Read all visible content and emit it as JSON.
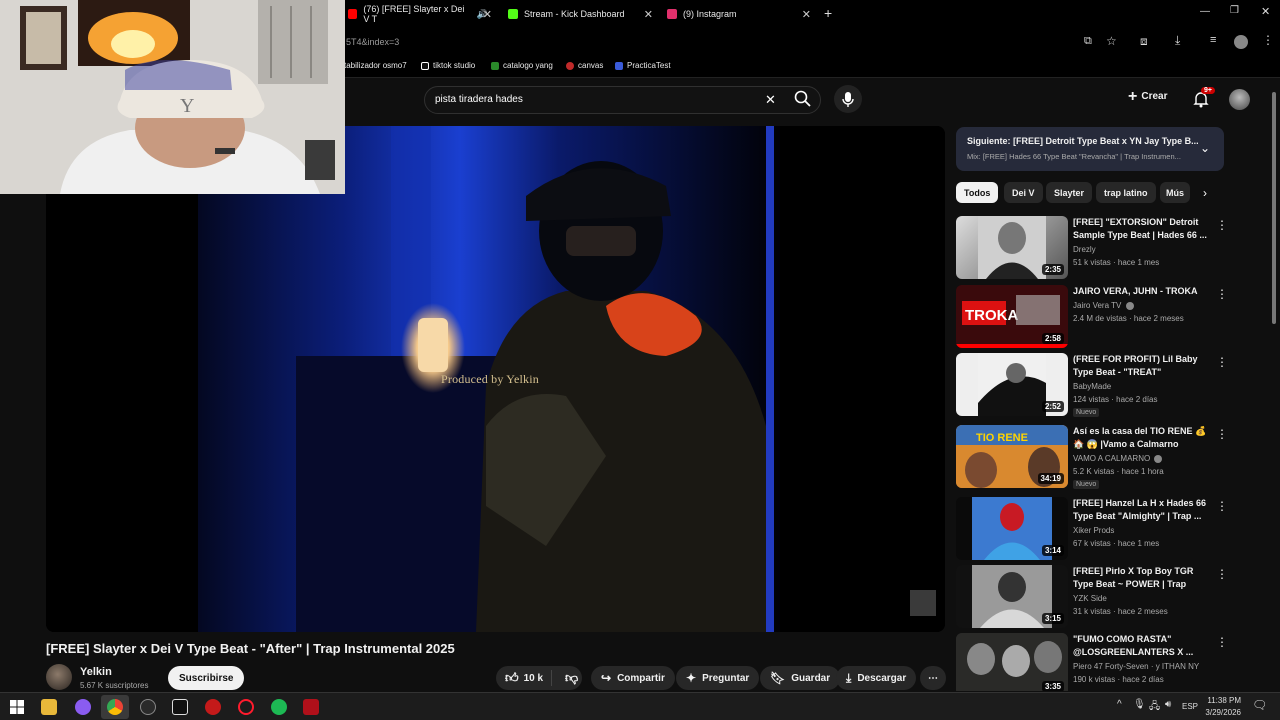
{
  "browser": {
    "tabs": [
      {
        "label": "(76) [FREE] Slayter x Dei V T",
        "color": "#ff0000"
      },
      {
        "label": "Stream - Kick Dashboard",
        "color": "#53fc18"
      },
      {
        "label": "(9) Instagram",
        "color": "#e1306c"
      }
    ],
    "url_fragment": "5T4&index=3",
    "bookmarks": [
      "tabilizador osmo7",
      "tiktok studio",
      "catalogo yang",
      "canvas",
      "PracticaTest"
    ]
  },
  "youtube": {
    "search_value": "pista tiradera hades",
    "create_label": "Crear",
    "notif_count": "9+",
    "video": {
      "overlay_text": "Produced by Yelkin",
      "title": "[FREE] Slayter x Dei V Type Beat - \"After\" | Trap Instrumental 2025",
      "channel": "Yelkin",
      "subs": "5.67 K suscriptores",
      "subscribe": "Suscribirse",
      "likes": "10 k",
      "share": "Compartir",
      "ask": "Preguntar",
      "save": "Guardar",
      "download": "Descargar"
    },
    "next": {
      "label": "Siguiente:",
      "title": "[FREE] Detroit Type Beat x YN Jay Type B...",
      "sub": "Mix: [FREE] Hades 66 Type Beat \"Revancha\" | Trap Instrumen..."
    },
    "chips": [
      "Todos",
      "Dei V",
      "Slayter",
      "trap latino",
      "Mús"
    ],
    "recs": [
      {
        "title": "[FREE] \"EXTORSION\" Detroit Sample Type Beat | Hades 66 ...",
        "channel": "Drezly",
        "meta": "51 k vistas · hace 1 mes",
        "dur": "2:35",
        "badge": ""
      },
      {
        "title": "JAIRO VERA, JUHN - TROKA",
        "channel": "Jairo Vera TV",
        "meta": "2.4 M de vistas · hace 2 meses",
        "dur": "2:58",
        "badge": ""
      },
      {
        "title": "(FREE FOR PROFIT) Lil Baby Type Beat - \"TREAT\"",
        "channel": "BabyMade",
        "meta": "124 vistas · hace 2 días",
        "dur": "2:52",
        "badge": "Nuevo"
      },
      {
        "title": "Así es la casa del TIO RENE 💰 🏠 😱 |Vamo a Calmarno",
        "channel": "VAMO A CALMARNO",
        "meta": "5.2 K vistas · hace 1 hora",
        "dur": "34:19",
        "badge": "Nuevo"
      },
      {
        "title": "[FREE] Hanzel La H x Hades 66 Type Beat \"Almighty\" | Trap ...",
        "channel": "Xiker Prods",
        "meta": "67 k vistas · hace 1 mes",
        "dur": "3:14",
        "badge": ""
      },
      {
        "title": "[FREE] Pirlo X Top Boy TGR Type Beat ~ POWER | Trap Detroit ...",
        "channel": "YZK Side",
        "meta": "31 k vistas · hace 2 meses",
        "dur": "3:15",
        "badge": ""
      },
      {
        "title": "\"FUMO COMO RASTA\" @LOSGREENLANTERS X ...",
        "channel": "Piero 47 Forty-Seven · y ITHAN NY",
        "meta": "190 k vistas · hace 2 días",
        "dur": "3:35",
        "badge": ""
      }
    ]
  },
  "taskbar": {
    "lang": "ESP",
    "time": "11:38 PM",
    "date": "3/29/2026"
  },
  "colors": {
    "bg": "#0f0f0f",
    "accent_red": "#ff0000",
    "chip_bg": "#272727"
  }
}
